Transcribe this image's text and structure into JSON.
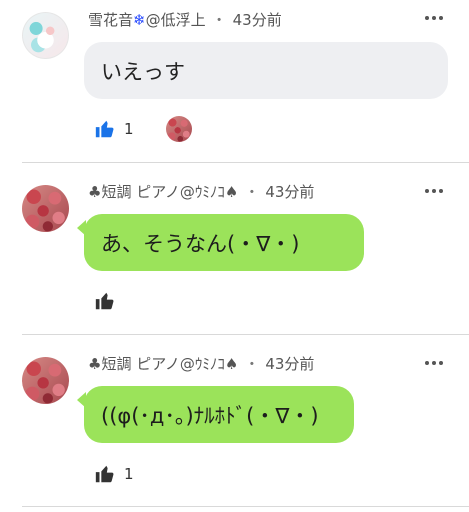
{
  "comments": [
    {
      "user": "雪花音",
      "user_mark": "❄",
      "handle": "@低浮上",
      "separator": "・",
      "time": "43分前",
      "text": "いえっす",
      "likes": "1",
      "avatar_icon": "anime-avatar",
      "like_icon_color": "#1a73e8"
    },
    {
      "user": "♣短調 ピアノ@ｳﾐﾉｺ♠",
      "handle": "",
      "separator": "・",
      "time": "43分前",
      "text": "あ、そうなん(・∇・)",
      "likes": "",
      "avatar_icon": "roses-avatar",
      "like_icon_color": "#333333"
    },
    {
      "user": "♣短調 ピアノ@ｳﾐﾉｺ♠",
      "handle": "",
      "separator": "・",
      "time": "43分前",
      "text": "((φ(･д･｡)ﾅﾙﾎﾄﾞ(・∇・)",
      "likes": "1",
      "avatar_icon": "roses-avatar",
      "like_icon_color": "#333333"
    }
  ],
  "colors": {
    "gray_bubble": "#eeeff2",
    "green_bubble": "#9be35a",
    "divider": "#d9d9d9"
  }
}
